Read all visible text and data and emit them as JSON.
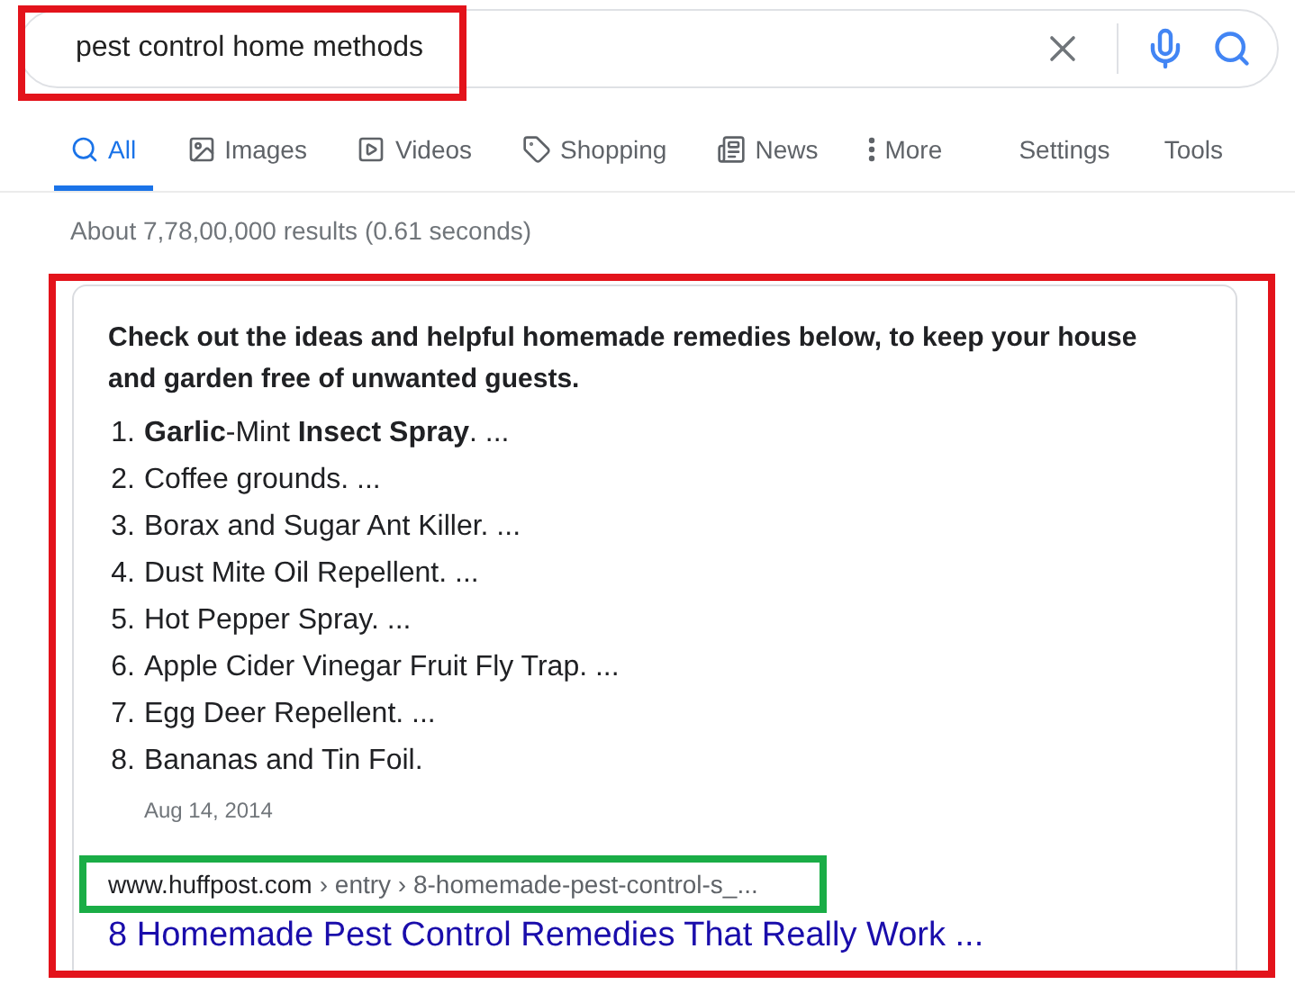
{
  "search": {
    "value": "pest control home methods"
  },
  "tabs": [
    {
      "label": "All",
      "selected": true
    },
    {
      "label": "Images",
      "selected": false
    },
    {
      "label": "Videos",
      "selected": false
    },
    {
      "label": "Shopping",
      "selected": false
    },
    {
      "label": "News",
      "selected": false
    },
    {
      "label": "More",
      "selected": false
    }
  ],
  "tools": [
    "Settings",
    "Tools"
  ],
  "result_stats": "About 7,78,00,000 results (0.61 seconds)",
  "snippet": {
    "heading": "Check out the ideas and helpful homemade remedies below, to keep your house and garden free of unwanted guests.",
    "items": [
      {
        "marker": "1.",
        "text": "**Garlic**-Mint **Insect Spray**. ..."
      },
      {
        "marker": "2.",
        "text": "Coffee grounds. ..."
      },
      {
        "marker": "3.",
        "text": "Borax and Sugar Ant Killer. ..."
      },
      {
        "marker": "4.",
        "text": "Dust Mite Oil Repellent. ..."
      },
      {
        "marker": "5.",
        "text": "Hot Pepper Spray. ..."
      },
      {
        "marker": "6.",
        "text": "Apple Cider Vinegar Fruit Fly Trap. ..."
      },
      {
        "marker": "7.",
        "text": "Egg Deer Repellent. ..."
      },
      {
        "marker": "8.",
        "text": "Bananas and Tin Foil."
      }
    ],
    "date": "Aug 14, 2014",
    "source": {
      "domain": "www.huffpost.com",
      "path": "› entry › 8-homemade-pest-control-s_..."
    },
    "title": "8 Homemade Pest Control Remedies That Really Work ..."
  }
}
